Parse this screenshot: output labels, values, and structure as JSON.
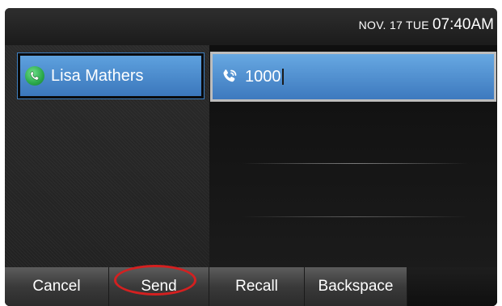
{
  "status_bar": {
    "date": "NOV. 17 TUE",
    "time": "07:40AM"
  },
  "line_key": {
    "label": "Lisa Mathers",
    "icon": "presence-available-icon",
    "status_color": "#2aa84a"
  },
  "dial_field": {
    "value": "1000",
    "icon": "phone-handset-icon"
  },
  "softkeys": [
    {
      "label": "Cancel"
    },
    {
      "label": "Send"
    },
    {
      "label": "Recall"
    },
    {
      "label": "Backspace"
    }
  ],
  "highlight": {
    "target": "Send",
    "color": "#d42020"
  },
  "colors": {
    "accent_blue": "#4a8ed0",
    "softkey_bg": "#3a3a3a",
    "screen_bg": "#1a1a1a"
  }
}
